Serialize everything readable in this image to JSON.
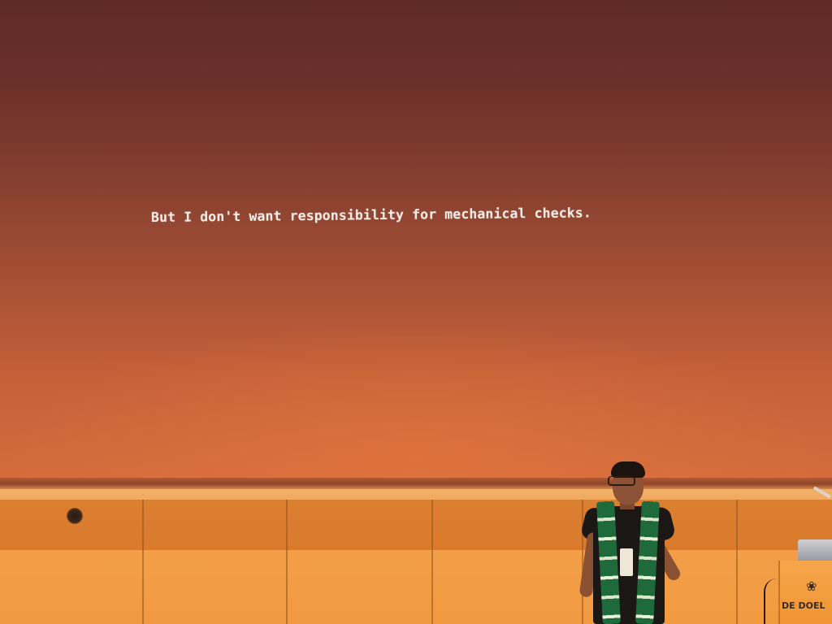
{
  "slide": {
    "text": "But I don't want responsibility for mechanical checks."
  },
  "podium": {
    "text": "DE DOEL",
    "logo_icon": "clover-logo-icon"
  },
  "colors": {
    "screen_top": "#5e2a26",
    "screen_bottom": "#d46c3c",
    "wall": "#ee9440",
    "slide_text": "#f3ece6",
    "scarf_green": "#1f6a3a"
  }
}
